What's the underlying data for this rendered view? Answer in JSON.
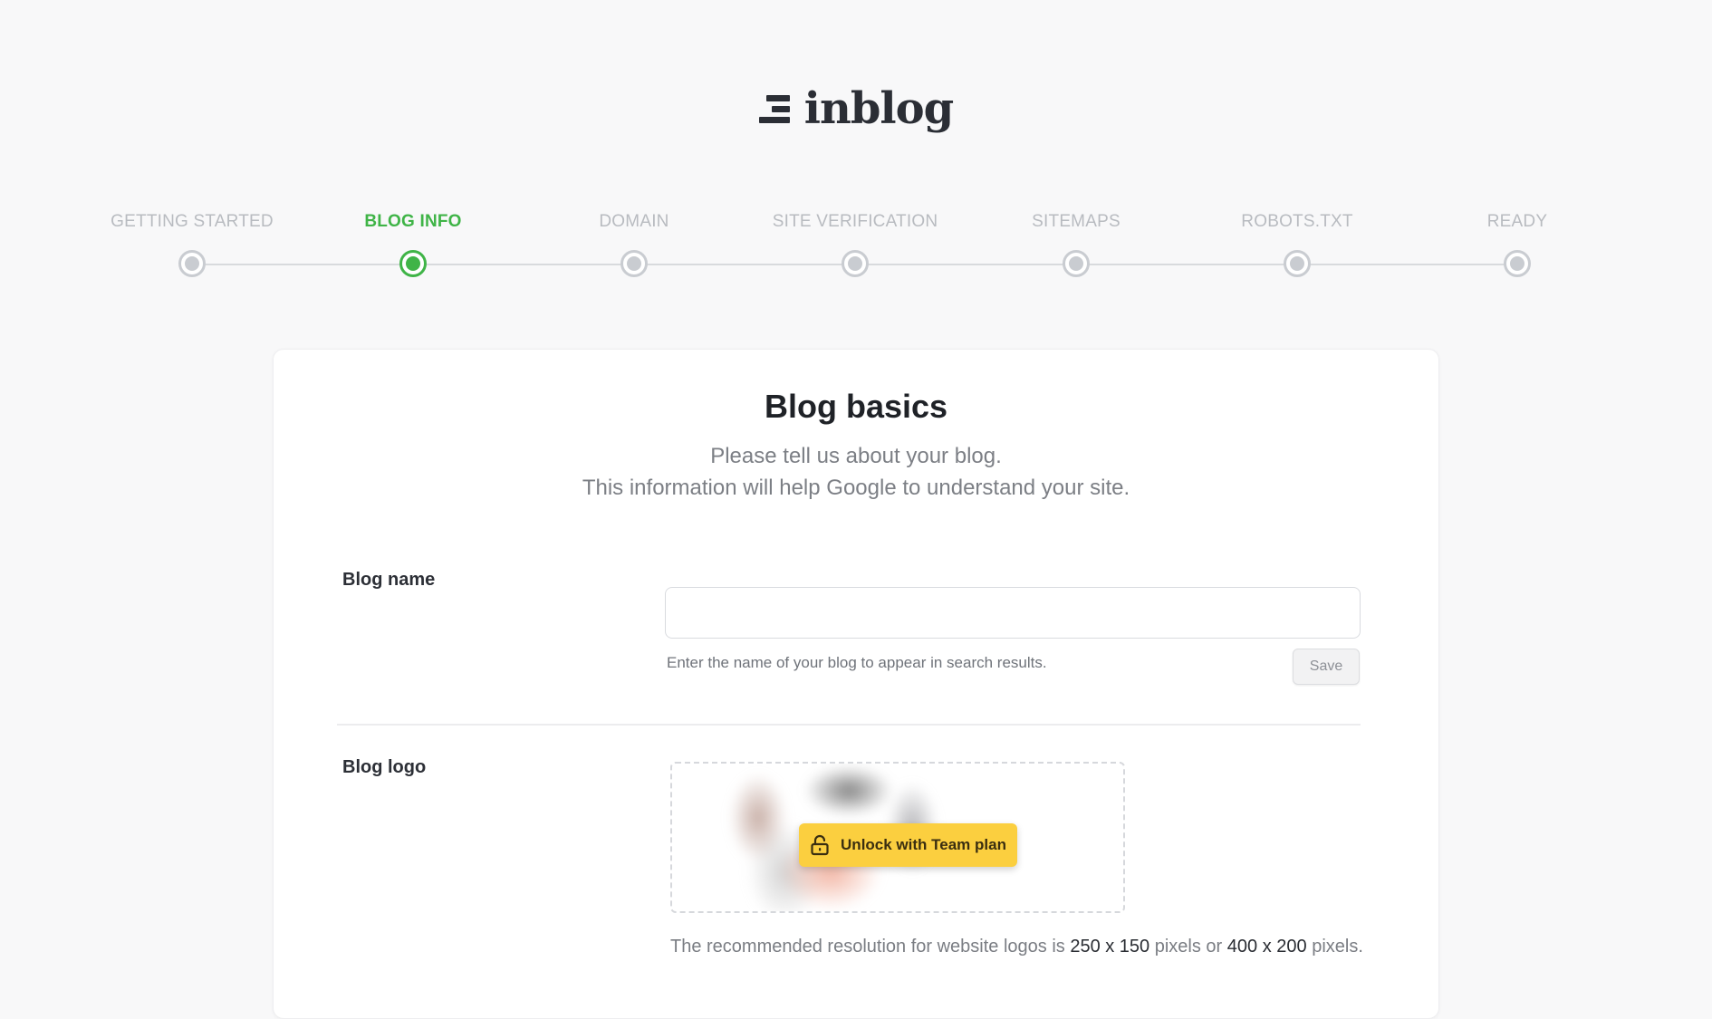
{
  "brand": {
    "name": "inblog"
  },
  "steps": [
    {
      "label": "GETTING STARTED",
      "active": false
    },
    {
      "label": "BLOG INFO",
      "active": true
    },
    {
      "label": "DOMAIN",
      "active": false
    },
    {
      "label": "SITE VERIFICATION",
      "active": false
    },
    {
      "label": "SITEMAPS",
      "active": false
    },
    {
      "label": "ROBOTS.TXT",
      "active": false
    },
    {
      "label": "READY",
      "active": false
    }
  ],
  "card": {
    "title": "Blog basics",
    "subtitle_line1": "Please tell us about your blog.",
    "subtitle_line2": "This information will help Google to understand your site."
  },
  "blog_name": {
    "label": "Blog name",
    "value": "",
    "help": "Enter the name of your blog to appear in search results.",
    "save_label": "Save"
  },
  "blog_logo": {
    "label": "Blog logo",
    "unlock_label": "Unlock with Team plan",
    "res_prefix": "The recommended resolution for website logos is ",
    "res_a": "250 x 150",
    "res_mid": " pixels or ",
    "res_b": "400 x 200",
    "res_suffix": " pixels."
  },
  "colors": {
    "accent": "#3fb447",
    "unlock": "#fbcf3f"
  }
}
